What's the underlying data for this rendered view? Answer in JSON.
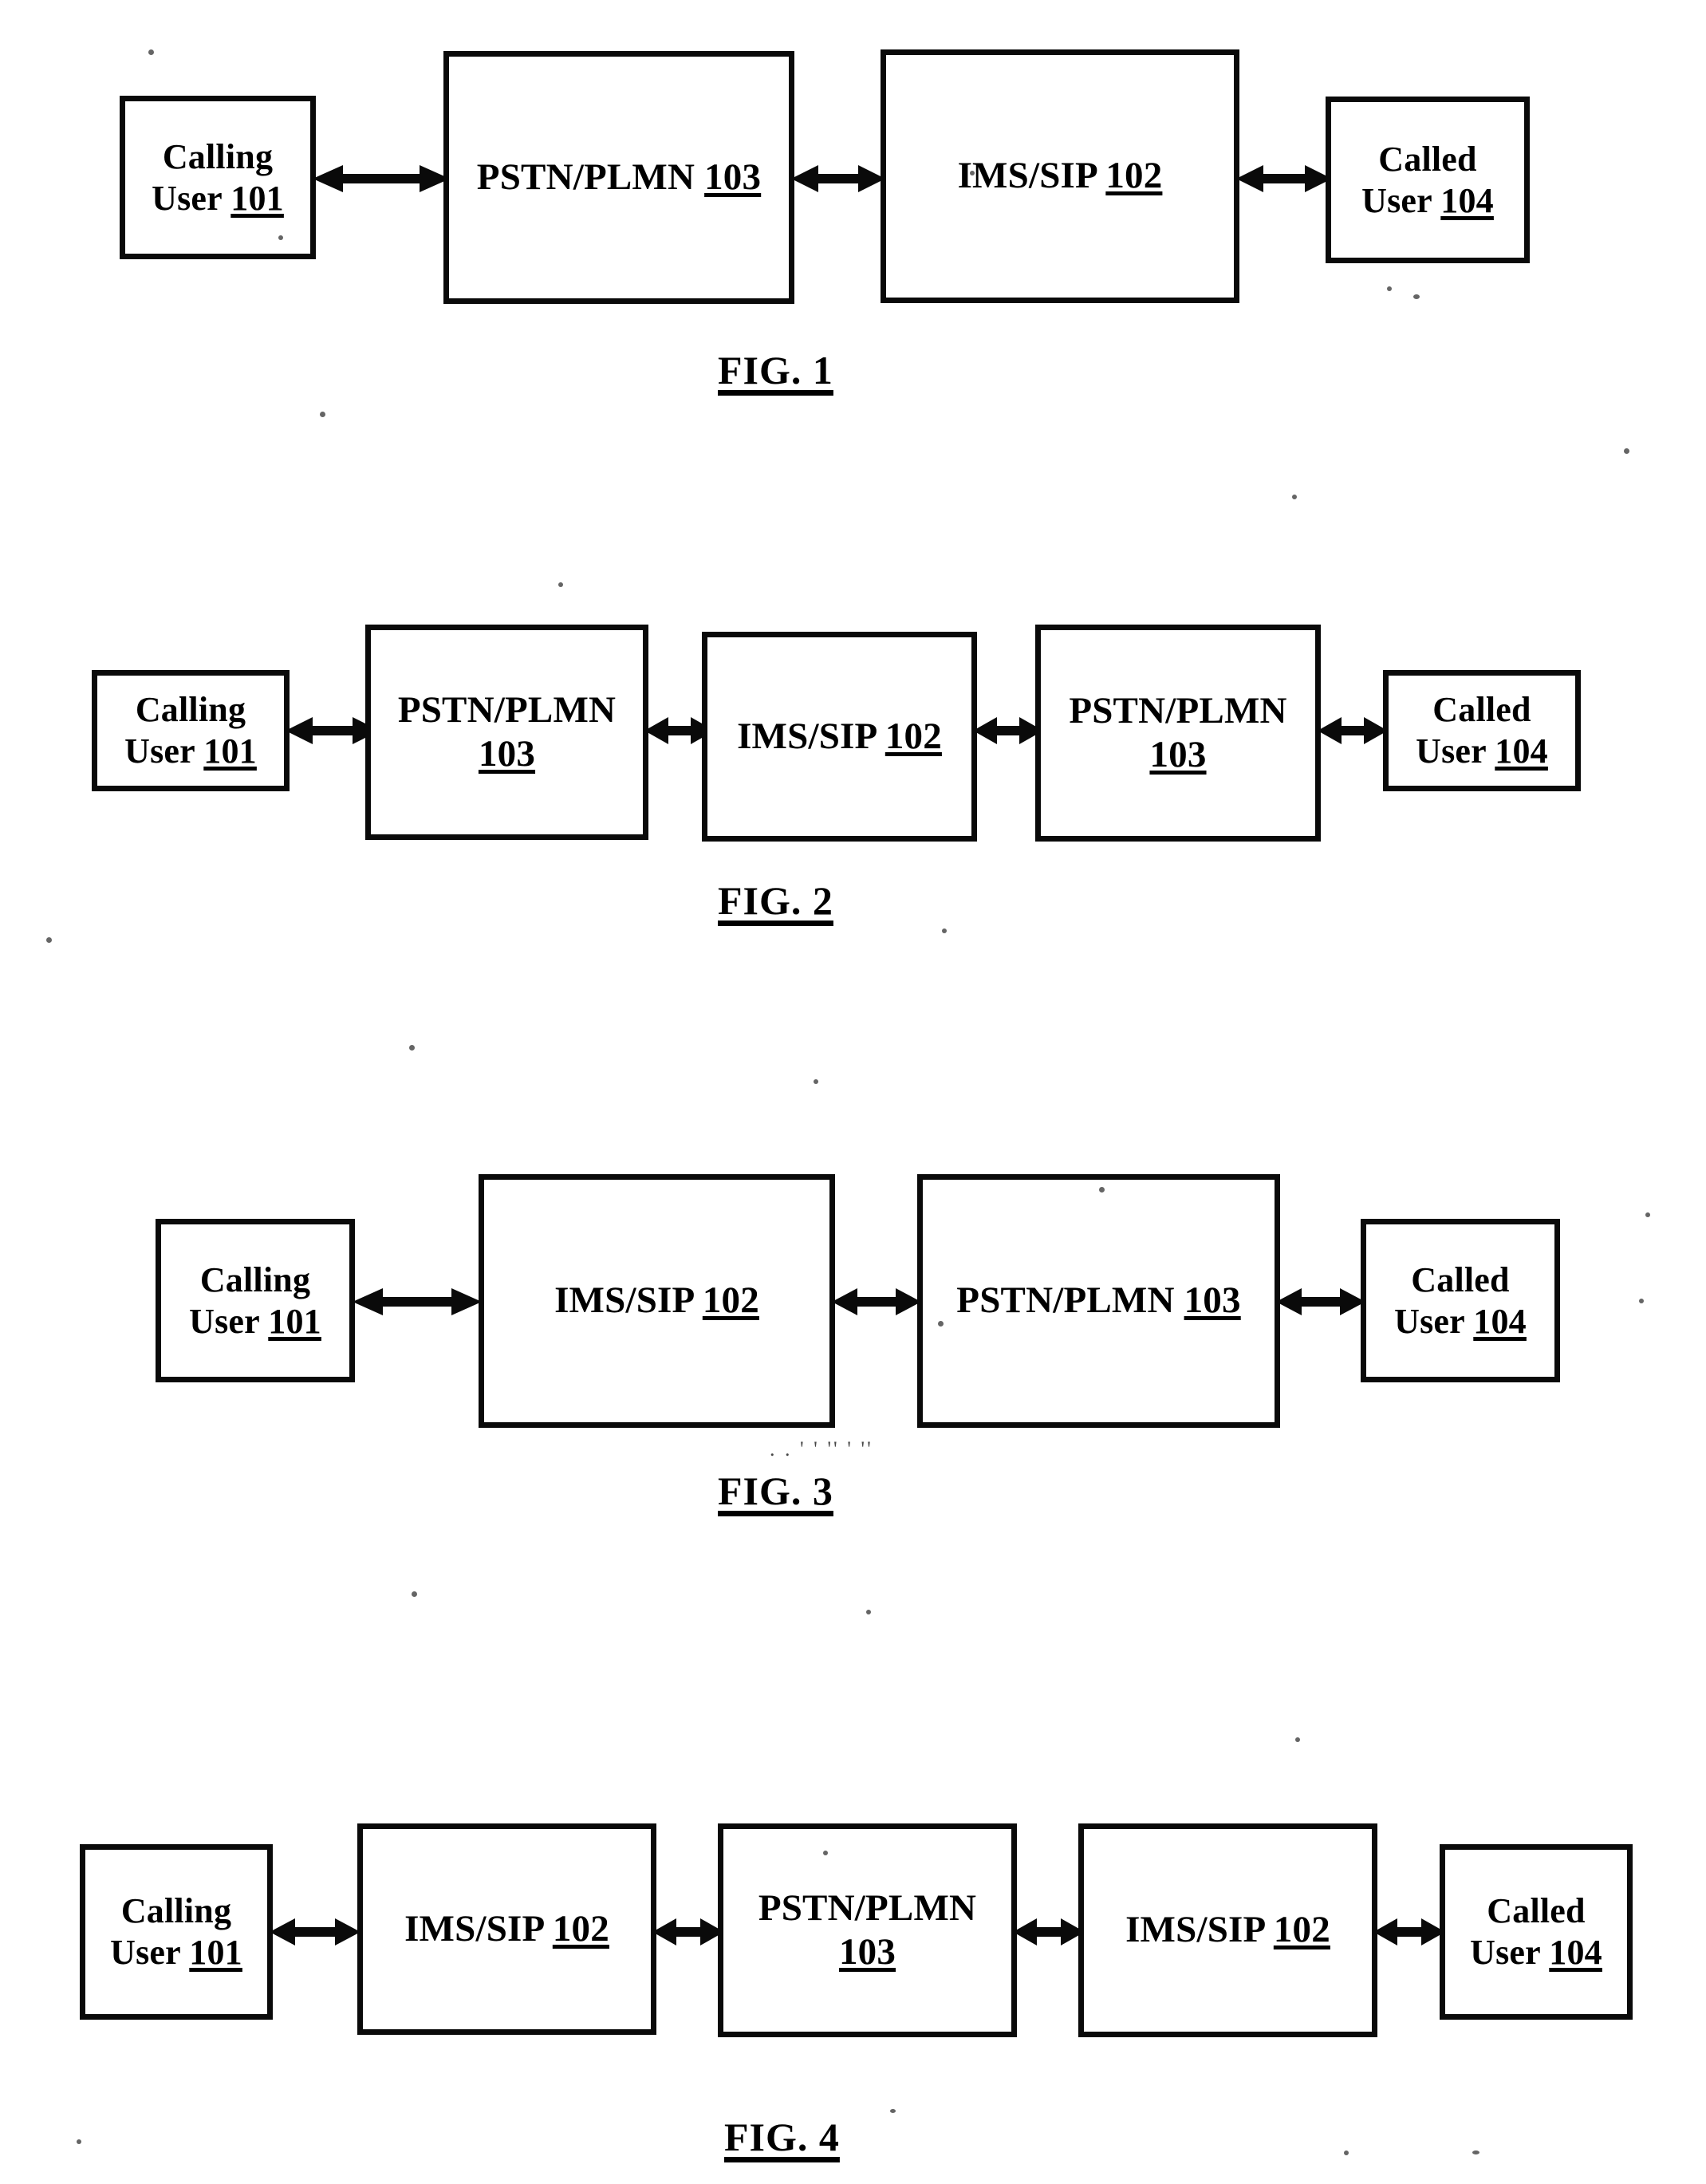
{
  "document": {
    "type": "patent-drawing-sheet",
    "background_color": "#ffffff",
    "ink_color": "#000000"
  },
  "nodes": {
    "calling_user": {
      "line1": "Calling",
      "line2": "User ",
      "ref": "101"
    },
    "called_user": {
      "line1": "Called",
      "line2": "User ",
      "ref": "104"
    },
    "pstn_plmn": {
      "name": "PSTN/PLMN",
      "ref": "103"
    },
    "ims_sip": {
      "name": "IMS/SIP",
      "ref": "102"
    }
  },
  "figures": [
    {
      "id": "fig1",
      "caption": "FIG. 1",
      "boxes": [
        {
          "key": "calling_user",
          "text": "Calling\nUser ",
          "ref": "101",
          "size": "small"
        },
        {
          "key": "pstn_plmn",
          "text": "PSTN/PLMN ",
          "ref": "103",
          "size": "big"
        },
        {
          "key": "ims_sip",
          "text": "IMS/SIP ",
          "ref": "102",
          "size": "big"
        },
        {
          "key": "called_user",
          "text": "Called\nUser ",
          "ref": "104",
          "size": "small"
        }
      ],
      "connectors": 3
    },
    {
      "id": "fig2",
      "caption": "FIG. 2",
      "boxes": [
        {
          "key": "calling_user",
          "text": "Calling\nUser ",
          "ref": "101",
          "size": "small"
        },
        {
          "key": "pstn_plmn",
          "text": "PSTN/PLMN\n",
          "ref": "103",
          "size": "big"
        },
        {
          "key": "ims_sip",
          "text": "IMS/SIP ",
          "ref": "102",
          "size": "big"
        },
        {
          "key": "pstn_plmn",
          "text": "PSTN/PLMN\n",
          "ref": "103",
          "size": "big"
        },
        {
          "key": "called_user",
          "text": "Called\nUser ",
          "ref": "104",
          "size": "small"
        }
      ],
      "connectors": 4
    },
    {
      "id": "fig3",
      "caption": "FIG. 3",
      "boxes": [
        {
          "key": "calling_user",
          "text": "Calling\nUser ",
          "ref": "101",
          "size": "small"
        },
        {
          "key": "ims_sip",
          "text": "IMS/SIP ",
          "ref": "102",
          "size": "big"
        },
        {
          "key": "pstn_plmn",
          "text": "PSTN/PLMN ",
          "ref": "103",
          "size": "big"
        },
        {
          "key": "called_user",
          "text": "Called\nUser ",
          "ref": "104",
          "size": "small"
        }
      ],
      "connectors": 3
    },
    {
      "id": "fig4",
      "caption": "FIG. 4",
      "boxes": [
        {
          "key": "calling_user",
          "text": "Calling\nUser ",
          "ref": "101",
          "size": "small"
        },
        {
          "key": "ims_sip",
          "text": "IMS/SIP ",
          "ref": "102",
          "size": "big"
        },
        {
          "key": "pstn_plmn",
          "text": "PSTN/PLMN\n",
          "ref": "103",
          "size": "big"
        },
        {
          "key": "ims_sip",
          "text": "IMS/SIP ",
          "ref": "102",
          "size": "big"
        },
        {
          "key": "called_user",
          "text": "Called\nUser ",
          "ref": "104",
          "size": "small"
        }
      ],
      "connectors": 4
    }
  ],
  "fig1": {
    "caption": "FIG. 1",
    "box1_text": "Calling\nUser ",
    "box1_ref": "101",
    "box2_text": "PSTN/PLMN ",
    "box2_ref": "103",
    "box3_text": "IMS/SIP ",
    "box3_ref": "102",
    "box4_text": "Called\nUser ",
    "box4_ref": "104"
  },
  "fig2": {
    "caption": "FIG. 2",
    "box1_text": "Calling\nUser ",
    "box1_ref": "101",
    "box2_text": "PSTN/PLMN\n",
    "box2_ref": "103",
    "box3_text": "IMS/SIP ",
    "box3_ref": "102",
    "box4_text": "PSTN/PLMN\n",
    "box4_ref": "103",
    "box5_text": "Called\nUser ",
    "box5_ref": "104"
  },
  "fig3": {
    "caption": "FIG. 3",
    "box1_text": "Calling\nUser ",
    "box1_ref": "101",
    "box2_text": "IMS/SIP ",
    "box2_ref": "102",
    "box3_text": "PSTN/PLMN ",
    "box3_ref": "103",
    "box4_text": "Called\nUser ",
    "box4_ref": "104"
  },
  "fig4": {
    "caption": "FIG. 4",
    "box1_text": "Calling\nUser ",
    "box1_ref": "101",
    "box2_text": "IMS/SIP ",
    "box2_ref": "102",
    "box3_text": "PSTN/PLMN\n",
    "box3_ref": "103",
    "box4_text": "IMS/SIP ",
    "box4_ref": "102",
    "box5_text": "Called\nUser ",
    "box5_ref": "104"
  },
  "artifacts": {
    "fig3_smudge": ". . ' ' ''  ' ''"
  }
}
